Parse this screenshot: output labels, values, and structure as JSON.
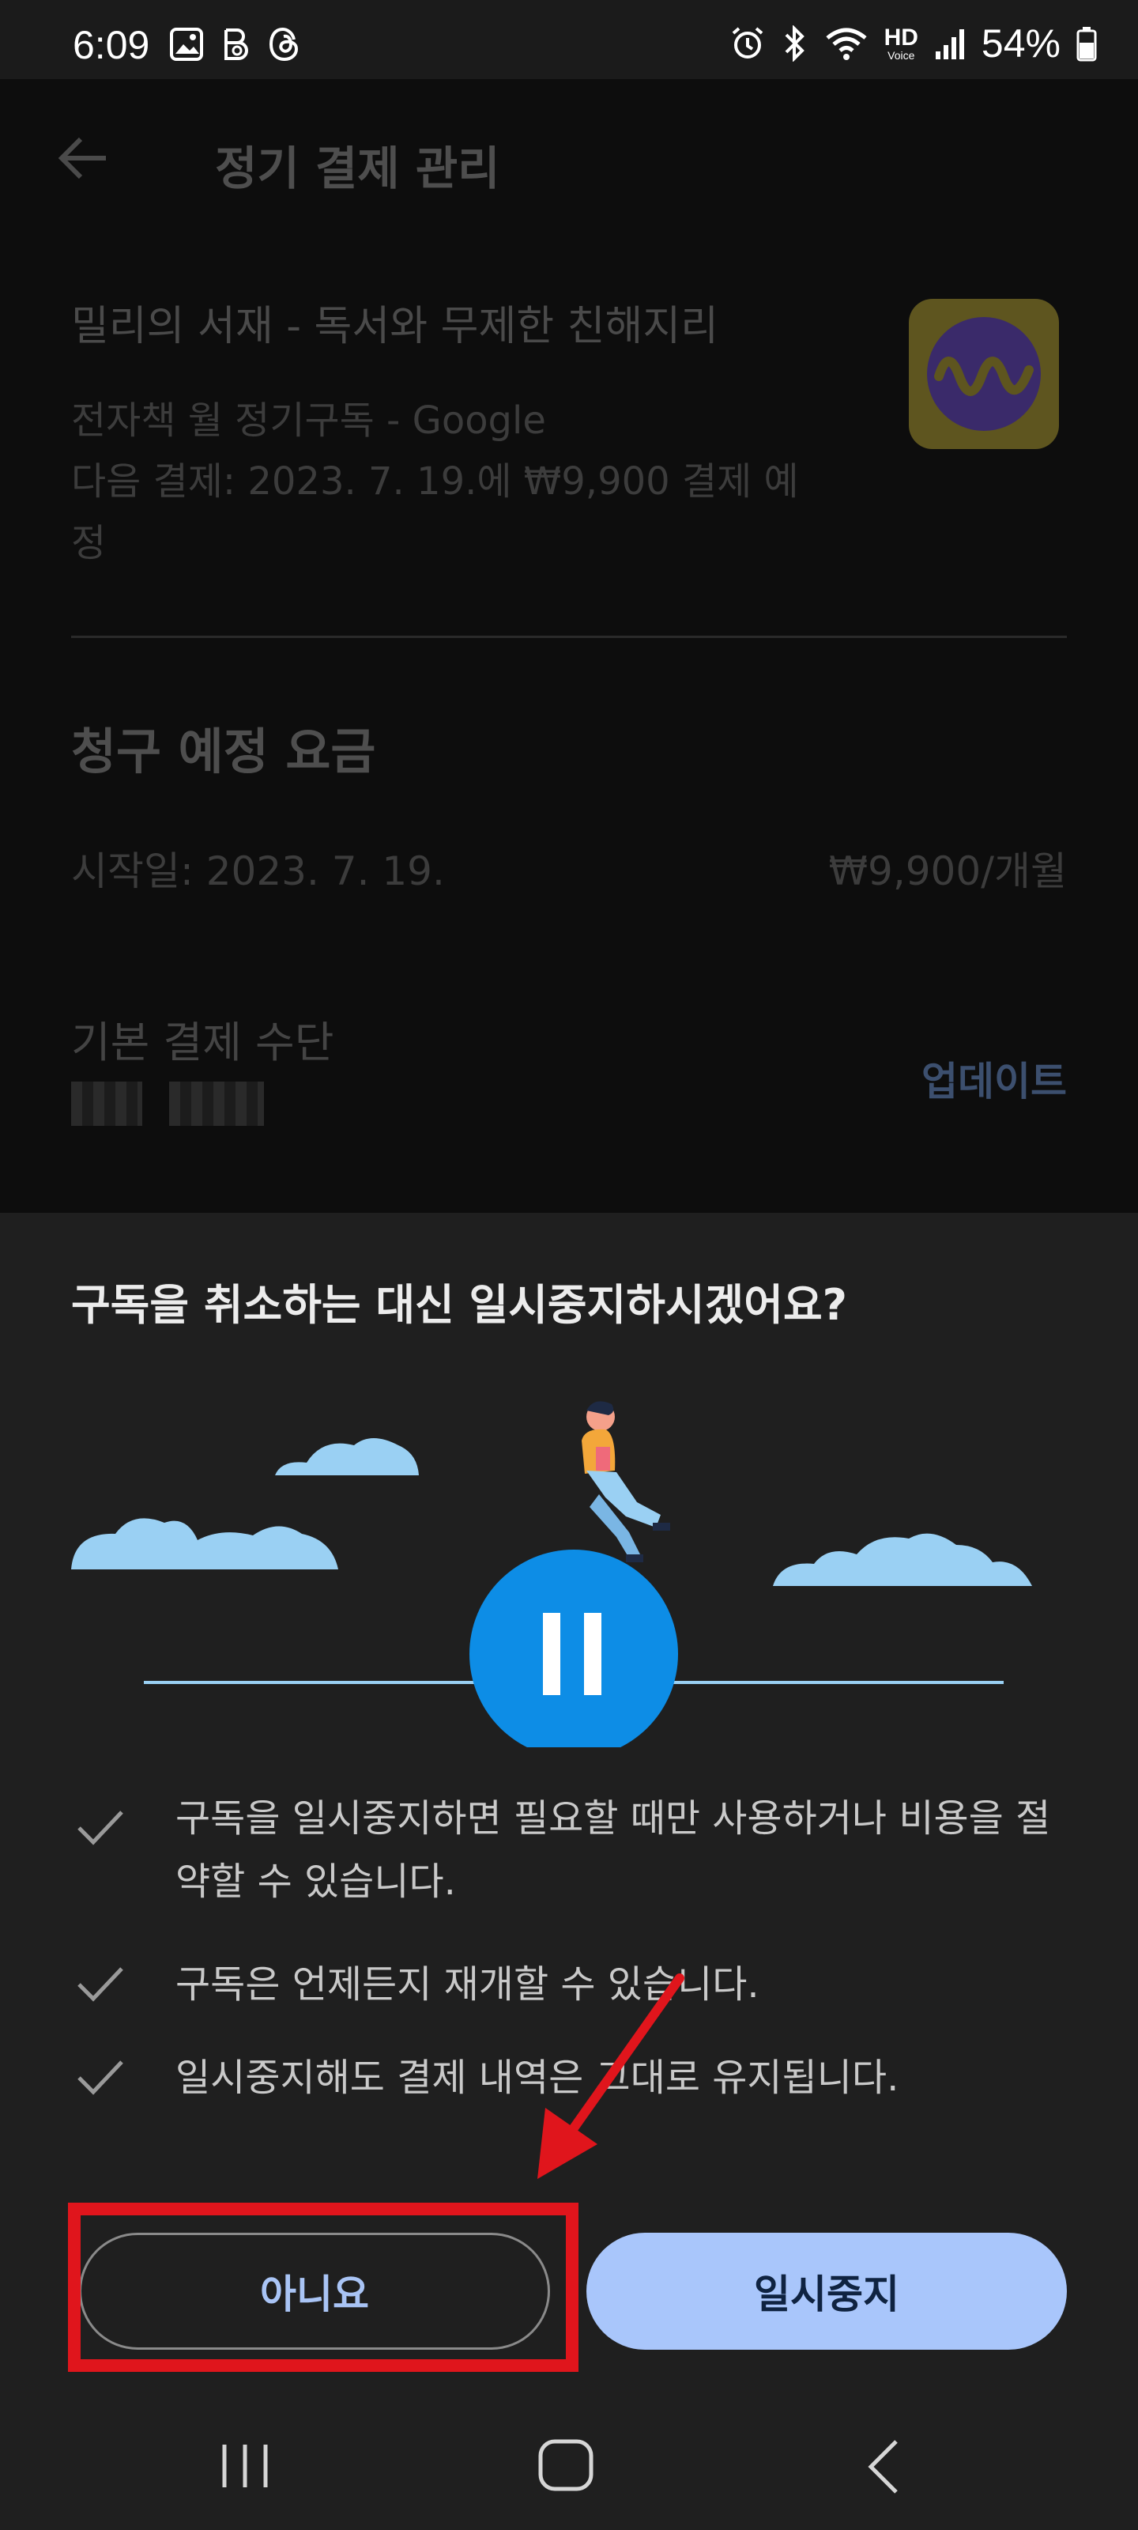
{
  "status_bar": {
    "time": "6:09",
    "battery": "54%",
    "hd_label": "HD",
    "voice_label": "Voice"
  },
  "header": {
    "title": "정기 결제 관리"
  },
  "subscription": {
    "app_name": "밀리의 서재 - 독서와 무제한 친해지리",
    "plan": "전자책 월 정기구독 - Google",
    "next_payment": "다음 결제: 2023. 7. 19.에 ₩9,900 결제 예정"
  },
  "billing": {
    "title": "청구 예정 요금",
    "start_date": "시작일: 2023. 7. 19.",
    "price": "₩9,900/개월",
    "payment_method_label": "기본 결제 수단",
    "update_link": "업데이트"
  },
  "sheet": {
    "title": "구독을 취소하는 대신 일시중지하시겠어요?",
    "benefits": [
      "구독을 일시중지하면 필요할 때만 사용하거나 비용을 절약할 수 있습니다.",
      "구독은 언제든지 재개할 수 있습니다.",
      "일시중지해도 결제 내역은 그대로 유지됩니다."
    ],
    "no_button": "아니요",
    "pause_button": "일시중지"
  },
  "colors": {
    "accent": "#a9c6fb",
    "annotation_red": "#e0151c",
    "app_icon_bg": "#5e551f",
    "app_icon_fg": "#3a2a6a"
  },
  "icons": {
    "back": "arrow-left-icon",
    "check": "check-icon",
    "nav_recents": "recents-icon",
    "nav_home": "home-icon",
    "nav_back": "chevron-left-icon"
  }
}
